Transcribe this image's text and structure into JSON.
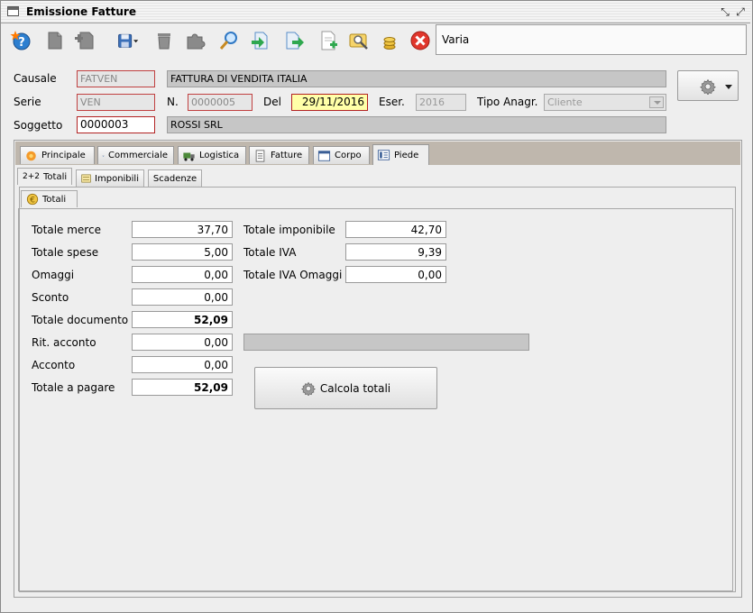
{
  "window": {
    "title": "Emissione Fatture"
  },
  "toolbar": {
    "icons": [
      "help-star-icon",
      "document-icon",
      "add-document-icon",
      "save-icon",
      "trash-icon",
      "puzzle-icon",
      "search-icon",
      "import-icon",
      "export-icon",
      "new-page-icon",
      "user-search-icon",
      "coins-icon",
      "cancel-icon"
    ],
    "varia_label": "Varia"
  },
  "header": {
    "causale_label": "Causale",
    "causale_code": "FATVEN",
    "causale_desc": "FATTURA DI VENDITA ITALIA",
    "serie_label": "Serie",
    "serie_value": "VEN",
    "numero_label": "N.",
    "numero_value": "0000005",
    "del_label": "Del",
    "del_value": "29/11/2016",
    "eser_label": "Eser.",
    "eser_value": "2016",
    "tipo_anagr_label": "Tipo Anagr.",
    "tipo_anagr_value": "Cliente",
    "soggetto_label": "Soggetto",
    "soggetto_code": "0000003",
    "soggetto_name": "ROSSI SRL"
  },
  "tabs": [
    {
      "label": "Principale",
      "icon": "flower-icon"
    },
    {
      "label": "Commerciale",
      "icon": "network-icon"
    },
    {
      "label": "Logistica",
      "icon": "truck-icon"
    },
    {
      "label": "Fatture",
      "icon": "invoice-icon"
    },
    {
      "label": "Corpo",
      "icon": "window-icon"
    },
    {
      "label": "Piede",
      "icon": "footer-icon"
    }
  ],
  "subtabs": [
    {
      "label": "Totali",
      "prefix": "2+2"
    },
    {
      "label": "Imponibili"
    },
    {
      "label": "Scadenze"
    }
  ],
  "inner_tab": {
    "label": "Totali",
    "icon": "euro-icon"
  },
  "totals_left": [
    {
      "label": "Totale merce",
      "value": "37,70",
      "bold": false
    },
    {
      "label": "Totale spese",
      "value": "5,00",
      "bold": false
    },
    {
      "label": "Omaggi",
      "value": "0,00",
      "bold": false
    },
    {
      "label": "Sconto",
      "value": "0,00",
      "bold": false
    },
    {
      "label": "Totale documento",
      "value": "52,09",
      "bold": true
    },
    {
      "label": "Rit. acconto",
      "value": "0,00",
      "bold": false
    },
    {
      "label": "Acconto",
      "value": "0,00",
      "bold": false
    },
    {
      "label": "Totale a pagare",
      "value": "52,09",
      "bold": true
    }
  ],
  "totals_right": [
    {
      "label": "Totale imponibile",
      "value": "42,70"
    },
    {
      "label": "Totale IVA",
      "value": "9,39"
    },
    {
      "label": "Totale IVA Omaggi",
      "value": "0,00"
    }
  ],
  "calc_button": {
    "label": "Calcola totali"
  }
}
